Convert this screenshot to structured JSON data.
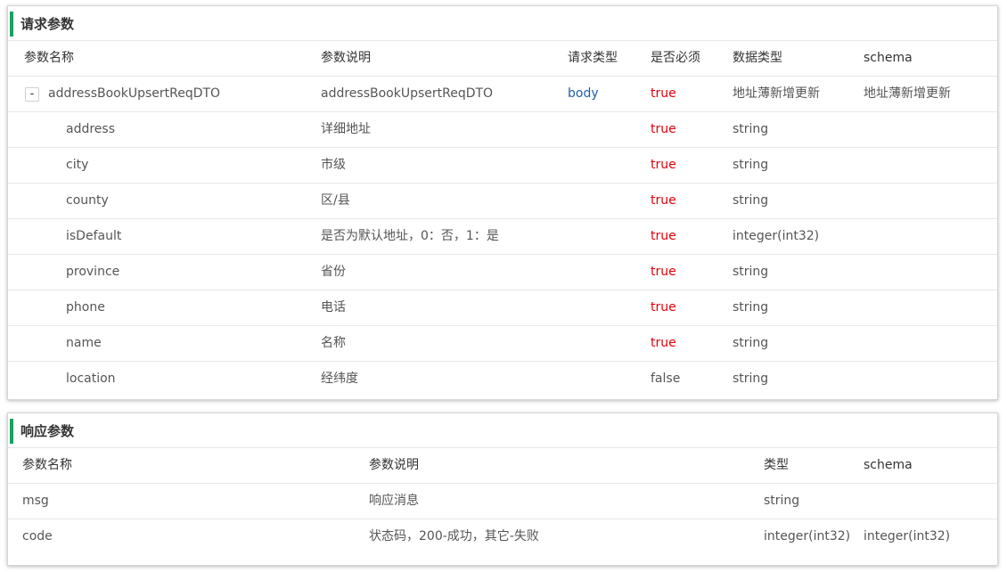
{
  "request_params": {
    "title": "请求参数",
    "headers": [
      "参数名称",
      "参数说明",
      "请求类型",
      "是否必须",
      "数据类型",
      "schema"
    ],
    "parent": {
      "toggle": "-",
      "name": "addressBookUpsertReqDTO",
      "desc": "addressBookUpsertReqDTO",
      "in": "body",
      "required": "true",
      "type": "地址薄新增更新",
      "schema": "地址薄新增更新"
    },
    "children": [
      {
        "name": "address",
        "desc": "详细地址",
        "required": "true",
        "type": "string"
      },
      {
        "name": "city",
        "desc": "市级",
        "required": "true",
        "type": "string"
      },
      {
        "name": "county",
        "desc": "区/县",
        "required": "true",
        "type": "string"
      },
      {
        "name": "isDefault",
        "desc": "是否为默认地址，0：否，1：是",
        "required": "true",
        "type": "integer(int32)"
      },
      {
        "name": "province",
        "desc": "省份",
        "required": "true",
        "type": "string"
      },
      {
        "name": "phone",
        "desc": "电话",
        "required": "true",
        "type": "string"
      },
      {
        "name": "name",
        "desc": "名称",
        "required": "true",
        "type": "string"
      },
      {
        "name": "location",
        "desc": "经纬度",
        "required": "false",
        "type": "string"
      }
    ]
  },
  "response_params": {
    "title": "响应参数",
    "headers": [
      "参数名称",
      "参数说明",
      "类型",
      "schema"
    ],
    "rows": [
      {
        "name": "msg",
        "desc": "响应消息",
        "type": "string",
        "schema": ""
      },
      {
        "name": "code",
        "desc": "状态码，200-成功，其它-失败",
        "type": "integer(int32)",
        "schema": "integer(int32)"
      }
    ]
  },
  "colors": {
    "accent_bar": "#1aa15f",
    "required_true": "#e3000b",
    "body_link": "#1f5fa8"
  }
}
